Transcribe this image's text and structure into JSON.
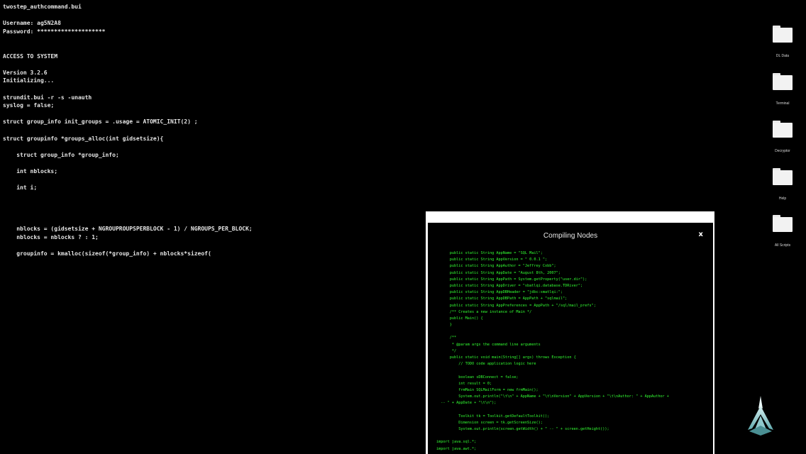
{
  "terminal": {
    "lines": [
      "twostep_authcommand.bui",
      "",
      "Username: ag5N2A8",
      "Password: ********************",
      "",
      "",
      "ACCESS TO SYSTEM",
      "",
      "Version 3.2.6",
      "Initializing...",
      "",
      "strundit.bui -r -s -unauth",
      "syslog = false;",
      "",
      "struct group_info init_groups = .usage = ATOMIC_INIT(2) ;",
      "",
      "struct groupinfo *groups_alloc(int gidsetsize){",
      "",
      "    struct group_info *group_info;",
      "",
      "    int nblocks;",
      "",
      "    int i;",
      "",
      "",
      "",
      "",
      "    nblocks = (gidsetsize + NGROUPROUPSPERBLOCK - 1) / NGROUPS_PER_BLOCK;",
      "    nblocks = nblocks ? : 1;",
      "",
      "    groupinfo = kmalloc(sizeof(*group_info) + nblocks*sizeof("
    ]
  },
  "desktop": {
    "icons": [
      {
        "label": "DL Data"
      },
      {
        "label": "Terminal"
      },
      {
        "label": "Decryptor"
      },
      {
        "label": "Help"
      },
      {
        "label": "All Scripts"
      }
    ]
  },
  "compile_window": {
    "title": "Compiling Nodes",
    "close_label": "x",
    "code_lines": [
      "      public static String AppName = \"SQL Mail\";",
      "      public static String AppVersion = \" 0.0.1 \";",
      "      public static String AppAuthor = \"Jeffrey Cobb\";",
      "      public static String AppDate = \"August 8th, 2007\";",
      "      public static String AppPath = System.getProperty(\"user.dir\");",
      "      public static String AppDriver = \"sbatlqi.database.TDRiver\";",
      "      public static String AppDBHeader = \"jdbc:smatlqi:\";",
      "      public static String AppDBPath = AppPath + \"sqlmail\";",
      "      public static String AppPreferences = AppPath + \"/sql/mail_prefs\";",
      "      /** Creates a new instance of Main */",
      "      public Main() {",
      "      }",
      "",
      "      /**",
      "       * @param args the command line arguments",
      "       */",
      "      public static void main(String[] args) throws Exception {",
      "          // TODO code application logic here",
      "",
      "          boolean sDBConnect = false;",
      "          int result = 0;",
      "          frmMain SQLMailForm = new frmMain();",
      "          System.out.println(\"\\t\\n\" + AppName + \"\\t\\nVersion\" + AppVersion + \"\\t\\nAuthor: \" + AppAuthor +",
      "  -- \" + AppDate + \"\\t\\n\");",
      "",
      "          Toolkit tk = Toolkit.getDefaultToolkit();",
      "          Dimension screen = tk.getScreenSize();",
      "          System.out.println(screen.getWidth() + \" -- \" + screen.getHeight());",
      "",
      "import java.sql.*;",
      "import java.awt.*;"
    ]
  },
  "colors": {
    "terminal_text": "#e6e6e6",
    "code_text": "#33ff33",
    "window_frame": "#ffffff",
    "background": "#000000"
  }
}
